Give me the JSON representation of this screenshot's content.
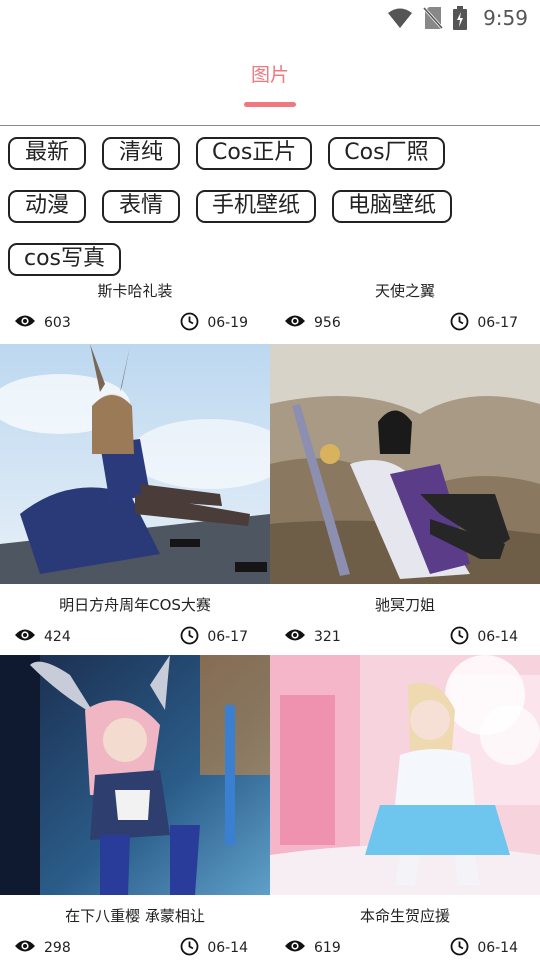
{
  "status_bar": {
    "time": "9:59",
    "icons": [
      "wifi-icon",
      "no-sim-icon",
      "battery-charging-icon"
    ]
  },
  "header": {
    "tab_label": "图片"
  },
  "categories": [
    "最新",
    "清纯",
    "Cos正片",
    "Cos厂照",
    "动漫",
    "表情",
    "手机壁纸",
    "电脑壁纸",
    "cos写真"
  ],
  "cards": [
    {
      "title": "斯卡哈礼装",
      "views": "603",
      "date": "06-19"
    },
    {
      "title": "天使之翼",
      "views": "956",
      "date": "06-17"
    },
    {
      "title": "明日方舟周年COS大赛",
      "views": "424",
      "date": "06-17"
    },
    {
      "title": "驰冥刀姐",
      "views": "321",
      "date": "06-14"
    },
    {
      "title": "在下八重樱 承蒙相让",
      "views": "298",
      "date": "06-14"
    },
    {
      "title": "本命生贺应援",
      "views": "619",
      "date": "06-14"
    }
  ],
  "colors": {
    "accent": "#f0787f",
    "chip_border": "#222222",
    "divider": "#8a8a8a"
  }
}
